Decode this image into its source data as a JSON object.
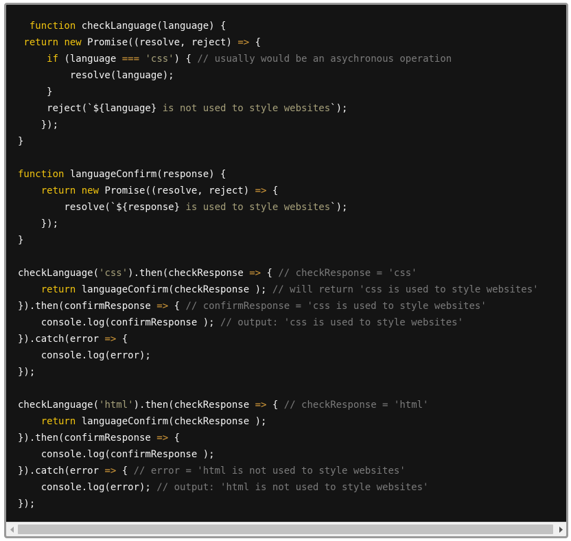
{
  "code_lines": [
    [
      [
        "kw",
        "  function "
      ],
      [
        "pl",
        "checkLanguage(language) {"
      ]
    ],
    [
      [
        "kw",
        " return "
      ],
      [
        "kw",
        "new "
      ],
      [
        "pl",
        "Promise((resolve, reject) "
      ],
      [
        "op",
        "=>"
      ],
      [
        "pl",
        " {"
      ]
    ],
    [
      [
        "kw",
        "     if "
      ],
      [
        "pl",
        "(language "
      ],
      [
        "op",
        "==="
      ],
      [
        "pl",
        " "
      ],
      [
        "str",
        "'css'"
      ],
      [
        "pl",
        ") { "
      ],
      [
        "cm",
        "// usually would be an asychronous operation"
      ]
    ],
    [
      [
        "pl",
        "         resolve(language);"
      ]
    ],
    [
      [
        "pl",
        "     }"
      ]
    ],
    [
      [
        "pl",
        "     reject(`${language} "
      ],
      [
        "str",
        "is not used to style websites"
      ],
      [
        "pl",
        "`);"
      ]
    ],
    [
      [
        "pl",
        "    });"
      ]
    ],
    [
      [
        "pl",
        "}"
      ]
    ],
    [
      [
        "pl",
        ""
      ]
    ],
    [
      [
        "kw",
        "function "
      ],
      [
        "pl",
        "languageConfirm(response) {"
      ]
    ],
    [
      [
        "kw",
        "    return "
      ],
      [
        "kw",
        "new "
      ],
      [
        "pl",
        "Promise((resolve, reject) "
      ],
      [
        "op",
        "=>"
      ],
      [
        "pl",
        " {"
      ]
    ],
    [
      [
        "pl",
        "        resolve(`${response} "
      ],
      [
        "str",
        "is used to style websites"
      ],
      [
        "pl",
        "`);"
      ]
    ],
    [
      [
        "pl",
        "    });"
      ]
    ],
    [
      [
        "pl",
        "}"
      ]
    ],
    [
      [
        "pl",
        ""
      ]
    ],
    [
      [
        "pl",
        "checkLanguage("
      ],
      [
        "str",
        "'css'"
      ],
      [
        "pl",
        ").then(checkResponse "
      ],
      [
        "op",
        "=>"
      ],
      [
        "pl",
        " { "
      ],
      [
        "cm",
        "// checkResponse = 'css'"
      ]
    ],
    [
      [
        "kw",
        "    return "
      ],
      [
        "pl",
        "languageConfirm(checkResponse ); "
      ],
      [
        "cm",
        "// will return 'css is used to style websites'"
      ]
    ],
    [
      [
        "pl",
        "}).then(confirmResponse "
      ],
      [
        "op",
        "=>"
      ],
      [
        "pl",
        " { "
      ],
      [
        "cm",
        "// confirmResponse = 'css is used to style websites'"
      ]
    ],
    [
      [
        "pl",
        "    console.log(confirmResponse ); "
      ],
      [
        "cm",
        "// output: 'css is used to style websites'"
      ]
    ],
    [
      [
        "pl",
        "}).catch(error "
      ],
      [
        "op",
        "=>"
      ],
      [
        "pl",
        " {"
      ]
    ],
    [
      [
        "pl",
        "    console.log(error);"
      ]
    ],
    [
      [
        "pl",
        "});"
      ]
    ],
    [
      [
        "pl",
        ""
      ]
    ],
    [
      [
        "pl",
        "checkLanguage("
      ],
      [
        "str",
        "'html'"
      ],
      [
        "pl",
        ").then(checkResponse "
      ],
      [
        "op",
        "=>"
      ],
      [
        "pl",
        " { "
      ],
      [
        "cm",
        "// checkResponse = 'html'"
      ]
    ],
    [
      [
        "kw",
        "    return "
      ],
      [
        "pl",
        "languageConfirm(checkResponse );"
      ]
    ],
    [
      [
        "pl",
        "}).then(confirmResponse "
      ],
      [
        "op",
        "=>"
      ],
      [
        "pl",
        " {"
      ]
    ],
    [
      [
        "pl",
        "    console.log(confirmResponse );"
      ]
    ],
    [
      [
        "pl",
        "}).catch(error "
      ],
      [
        "op",
        "=>"
      ],
      [
        "pl",
        " { "
      ],
      [
        "cm",
        "// error = 'html is not used to style websites'"
      ]
    ],
    [
      [
        "pl",
        "    console.log(error); "
      ],
      [
        "cm",
        "// output: 'html is not used to style websites'"
      ]
    ],
    [
      [
        "pl",
        "});"
      ]
    ]
  ],
  "colors": {
    "background": "#141414",
    "keyword": "#f1c40f",
    "string": "#a6a07a",
    "operator": "#d39a3a",
    "comment": "#7b7b7b",
    "text": "#f4f4f4"
  },
  "icons": {
    "scroll_left": "chevron-left-icon",
    "scroll_right": "chevron-right-icon"
  }
}
